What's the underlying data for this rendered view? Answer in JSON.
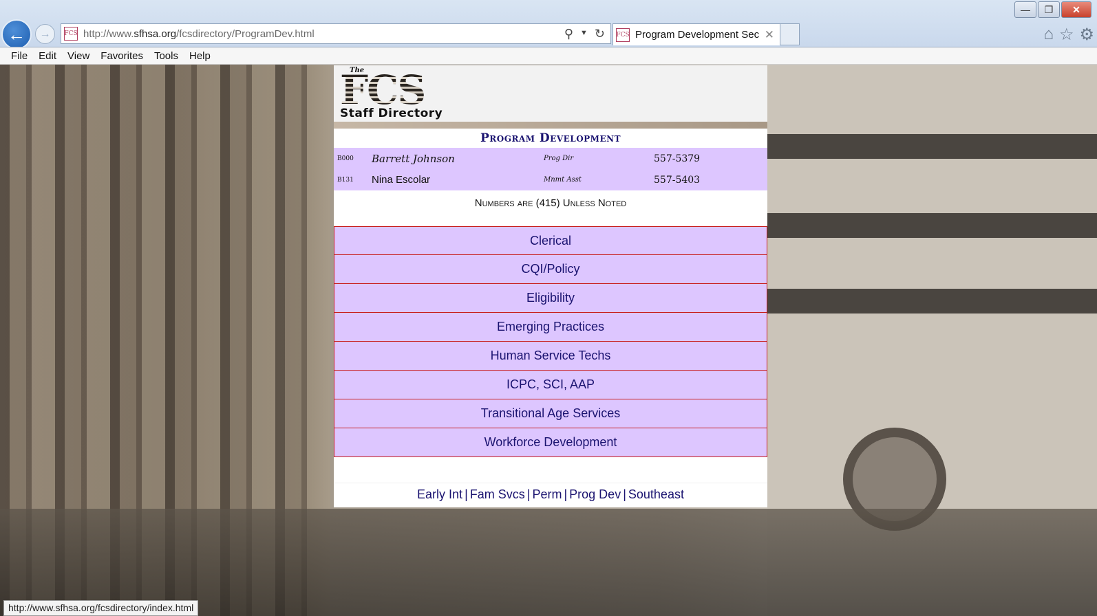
{
  "browser": {
    "url_prefix": "http://www.",
    "url_domain": "sfhsa.org",
    "url_path": "/fcsdirectory/ProgramDev.html",
    "tab_title": "Program Development Sec...",
    "favicon_text": "FCS",
    "menu": [
      "File",
      "Edit",
      "View",
      "Favorites",
      "Tools",
      "Help"
    ]
  },
  "logo": {
    "the": "The",
    "fcs": "FCS",
    "subtitle": "Staff Directory"
  },
  "page_title": "Program Development",
  "staff": [
    {
      "code": "B000",
      "name": "Barrett Johnson",
      "title": "Prog Dir",
      "phone": "557-5379"
    },
    {
      "code": "B131",
      "name": "Nina Escolar",
      "title": "Mnmt Asst",
      "phone": "557-5403"
    }
  ],
  "note": "Numbers are (415) Unless Noted",
  "units": [
    "Clerical",
    "CQI/Policy",
    "Eligibility",
    "Emerging Practices",
    "Human Service Techs",
    "ICPC, SCI, AAP",
    "Transitional Age Services",
    "Workforce Development"
  ],
  "footer_links": [
    "Early Int",
    "Fam Svcs",
    "Perm",
    "Prog Dev",
    "Southeast"
  ],
  "status_url": "http://www.sfhsa.org/fcsdirectory/index.html"
}
